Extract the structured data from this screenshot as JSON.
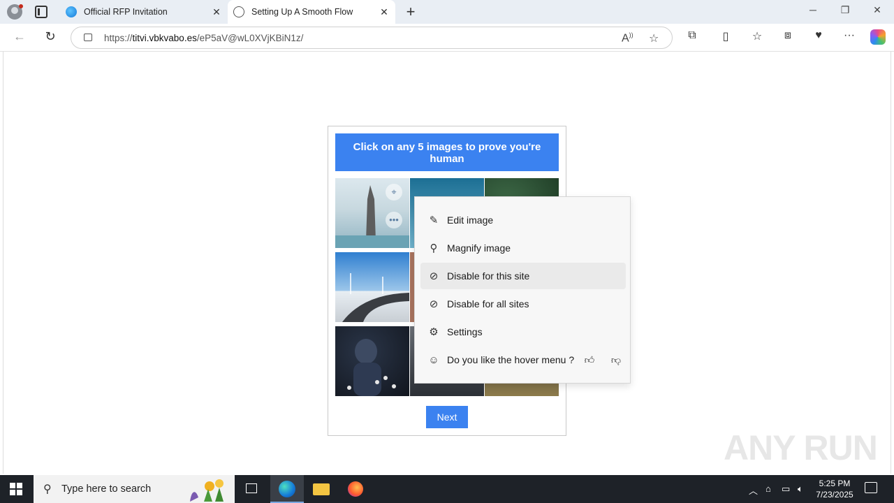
{
  "browser": {
    "tabs": [
      {
        "title": "Official RFP Invitation"
      },
      {
        "title": "Setting Up A Smooth Flow"
      }
    ],
    "url_prefix": "https://",
    "url_domain": "titvi.vbkvabo.es",
    "url_path": "/eP5aV@wL0XVjKBiN1z/"
  },
  "captcha": {
    "header": "Click on any 5 images to prove you're human",
    "next_label": "Next"
  },
  "context_menu": {
    "items": [
      {
        "label": "Edit image",
        "icon": "edit-image-icon"
      },
      {
        "label": "Magnify image",
        "icon": "magnify-icon"
      },
      {
        "label": "Disable for this site",
        "icon": "eye-off-icon"
      },
      {
        "label": "Disable for all sites",
        "icon": "eye-off-icon"
      },
      {
        "label": "Settings",
        "icon": "gear-icon"
      },
      {
        "label": "Do you like the hover menu ?",
        "icon": "feedback-icon"
      }
    ]
  },
  "taskbar": {
    "search_placeholder": "Type here to search",
    "time": "5:25 PM",
    "date": "7/23/2025"
  },
  "watermark": "ANY RUN"
}
